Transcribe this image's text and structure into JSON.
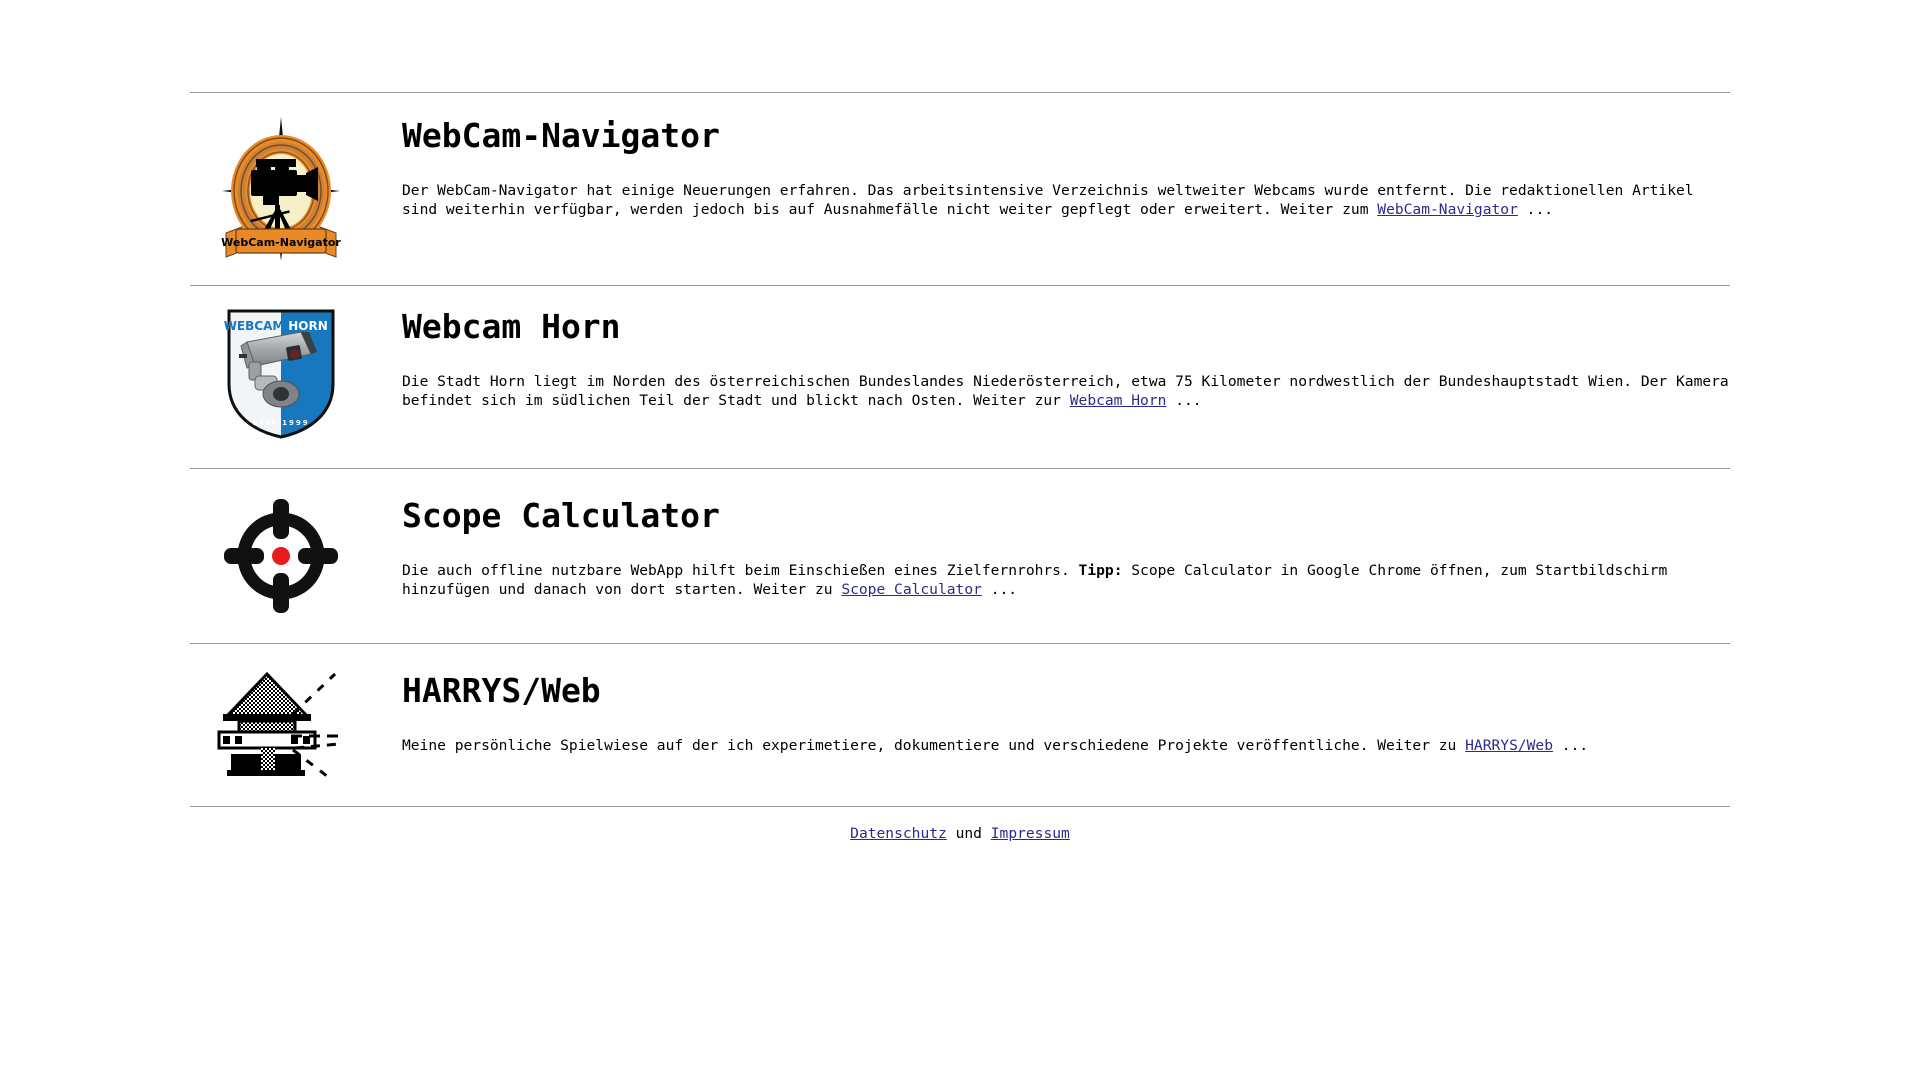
{
  "sections": [
    {
      "id": "webcam-navigator",
      "title": "WebCam-Navigator",
      "logo": "webcam-navigator-compass-logo",
      "logo_banner_text": "WebCam-Navigator",
      "desc_before": "Der WebCam-Navigator hat einige Neuerungen erfahren. Das arbeitsintensive Verzeichnis weltweiter Webcams wurde entfernt. Die redaktionellen Artikel sind weiterhin verfügbar, werden jedoch bis auf Ausnahmefälle nicht weiter gepflegt oder erweitert. Weiter zum ",
      "link_text": "WebCam-Navigator",
      "desc_after": " ..."
    },
    {
      "id": "webcam-horn",
      "title": "Webcam Horn",
      "logo": "webcam-horn-shield-logo",
      "logo_text_left": "WEBCAM",
      "logo_text_right": "HORN",
      "logo_text_bottom": "SEIT 1999",
      "desc_before": "Die Stadt Horn liegt im Norden des österreichischen Bundeslandes Niederösterreich, etwa 75 Kilometer nordwestlich der Bundeshauptstadt Wien. Der Kamera befindet sich im südlichen Teil der Stadt und blickt nach Osten. Weiter zur ",
      "link_text": "Webcam Horn",
      "desc_after": " ..."
    },
    {
      "id": "scope-calculator",
      "title": "Scope Calculator",
      "logo": "crosshair-reticle-icon",
      "desc_before": "Die auch offline nutzbare WebApp hilft beim Einschießen eines Zielfernrohrs. ",
      "tip_label": "Tipp:",
      "desc_middle": " Scope Calculator in Google Chrome öffnen, zum Startbildschirm hinzufügen und danach von dort starten. Weiter zu ",
      "link_text": "Scope Calculator",
      "desc_after": " ..."
    },
    {
      "id": "harrys-web",
      "title": "HARRYS/Web",
      "logo": "lighthouse-hut-icon",
      "desc_before": "Meine persönliche Spielwiese auf der ich experimetiere, dokumentiere und verschiedene Projekte veröffentliche. Weiter zu ",
      "link_text": "HARRYS/Web",
      "desc_after": " ..."
    }
  ],
  "footer": {
    "privacy_label": "Datenschutz",
    "conjunction": " und ",
    "imprint_label": "Impressum"
  },
  "colors": {
    "link": "#2b2b8f",
    "rule": "#9a9a9a",
    "logo_orange": "#e98a28",
    "logo_brown": "#a4682c",
    "logo_cream": "#f6f0c8",
    "shield_blue": "#1878bd",
    "shield_white": "#f2f5f7",
    "reticle_red": "#e81c1c",
    "text": "#000000"
  }
}
